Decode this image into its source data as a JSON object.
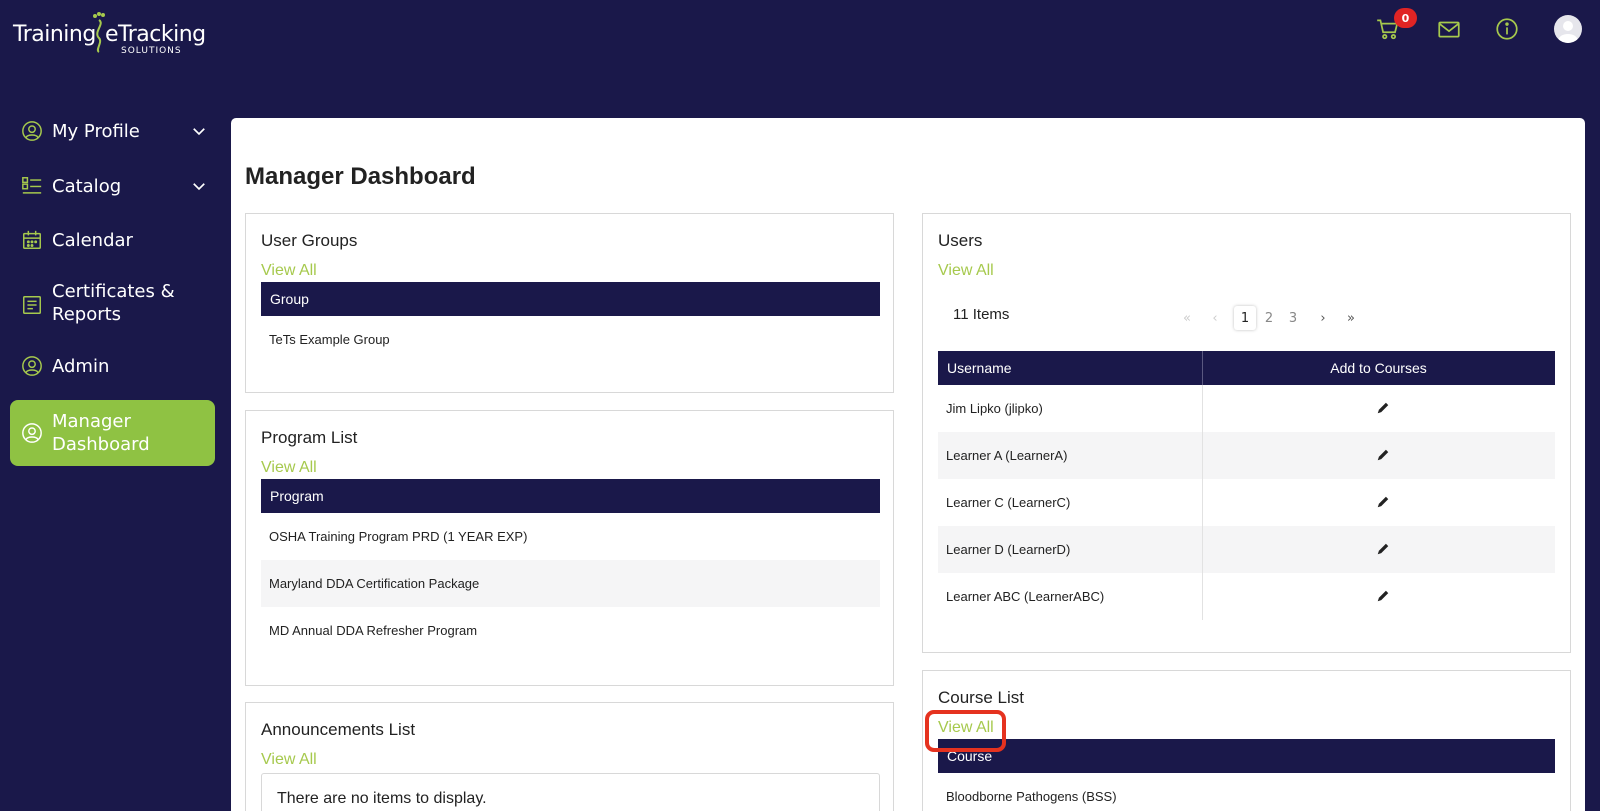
{
  "brand": {
    "logo_word1": "Training",
    "logo_word2": "eTracking",
    "logo_sub": "SOLUTIONS",
    "accent": "#a6c94d",
    "navy": "#1a184a",
    "active_green": "#8fc243"
  },
  "header": {
    "cart_count": "0",
    "icons": [
      "cart-icon",
      "mail-icon",
      "info-icon",
      "avatar"
    ]
  },
  "sidebar": {
    "items": [
      {
        "label": "My Profile",
        "icon": "user-circle-icon",
        "has_chevron": true
      },
      {
        "label": "Catalog",
        "icon": "list-icon",
        "has_chevron": true
      },
      {
        "label": "Calendar",
        "icon": "calendar-icon",
        "has_chevron": false
      },
      {
        "label": "Certificates &\nReports",
        "label_line1": "Certificates &",
        "label_line2": "Reports",
        "icon": "report-icon",
        "has_chevron": false
      },
      {
        "label": "Admin",
        "icon": "user-circle-icon",
        "has_chevron": false
      },
      {
        "label": "Manager Dashboard",
        "label_line1": "Manager",
        "label_line2": "Dashboard",
        "icon": "user-circle-icon",
        "has_chevron": false,
        "active": true
      }
    ]
  },
  "main": {
    "title": "Manager Dashboard",
    "user_groups": {
      "title": "User Groups",
      "view_all": "View All",
      "header": "Group",
      "rows": [
        "TeTs Example Group"
      ]
    },
    "program_list": {
      "title": "Program List",
      "view_all": "View All",
      "header": "Program",
      "rows": [
        "OSHA Training Program PRD (1 YEAR EXP)",
        "Maryland DDA Certification Package",
        "MD Annual DDA Refresher Program"
      ]
    },
    "announcements": {
      "title": "Announcements List",
      "view_all": "View All",
      "empty_text": "There are no items to display."
    },
    "users": {
      "title": "Users",
      "view_all": "View All",
      "count_text": "11 Items",
      "pages": [
        "1",
        "2",
        "3"
      ],
      "current_page": "1",
      "pager_first": "«",
      "pager_prev": "‹",
      "pager_next": "›",
      "pager_last": "»",
      "columns": [
        "Username",
        "Add to Courses"
      ],
      "rows": [
        "Jim Lipko (jlipko)",
        "Learner A (LearnerA)",
        "Learner C (LearnerC)",
        "Learner D (LearnerD)",
        "Learner ABC (LearnerABC)"
      ]
    },
    "course_list": {
      "title": "Course List",
      "view_all": "View All",
      "header": "Course",
      "rows": [
        "Bloodborne Pathogens (BSS)"
      ]
    }
  }
}
